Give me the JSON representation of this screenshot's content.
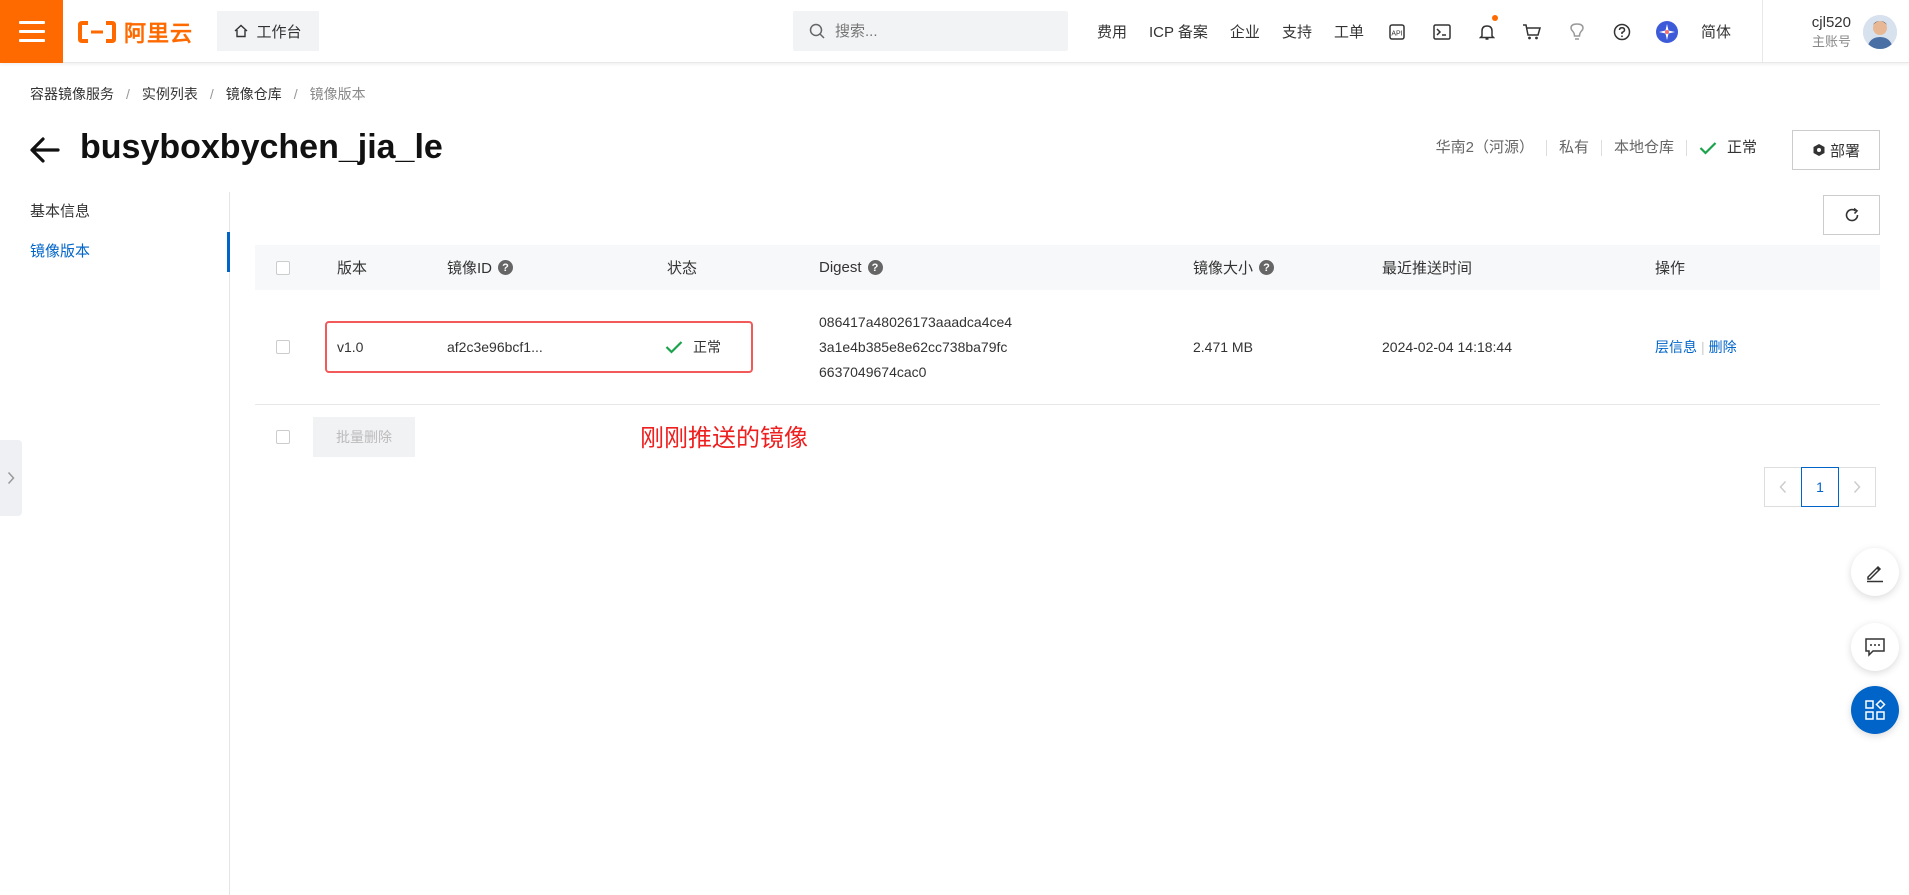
{
  "header": {
    "logo_text": "阿里云",
    "workbench_label": "工作台",
    "search_placeholder": "搜索...",
    "nav": [
      "费用",
      "ICP 备案",
      "企业",
      "支持",
      "工单"
    ],
    "lang_label": "简体",
    "user_name": "cjl520",
    "user_sub": "主账号",
    "brand_color": "#ff6a00"
  },
  "breadcrumb": [
    "容器镜像服务",
    "实例列表",
    "镜像仓库",
    "镜像版本"
  ],
  "page": {
    "title": "busyboxbychen_jia_le",
    "region": "华南2（河源）",
    "visibility": "私有",
    "repo_type": "本地仓库",
    "status": "正常",
    "deploy_label": "部署"
  },
  "sidebar": {
    "items": [
      {
        "label": "基本信息"
      },
      {
        "label": "镜像版本"
      }
    ]
  },
  "table": {
    "columns": [
      "版本",
      "镜像ID",
      "状态",
      "Digest",
      "镜像大小",
      "最近推送时间",
      "操作"
    ],
    "rows": [
      {
        "version": "v1.0",
        "image_id": "af2c3e96bcf1...",
        "status": "正常",
        "digest_1": "086417a48026173aaadca4ce4",
        "digest_2": "3a1e4b385e8e62cc738ba79fc",
        "digest_3": "6637049674cac0",
        "size": "2.471 MB",
        "pushed_at": "2024-02-04 14:18:44",
        "op_layers": "层信息",
        "op_delete": "删除"
      }
    ],
    "batch_delete_label": "批量删除"
  },
  "annotation": "刚刚推送的镜像",
  "pagination": {
    "current_page": "1"
  }
}
